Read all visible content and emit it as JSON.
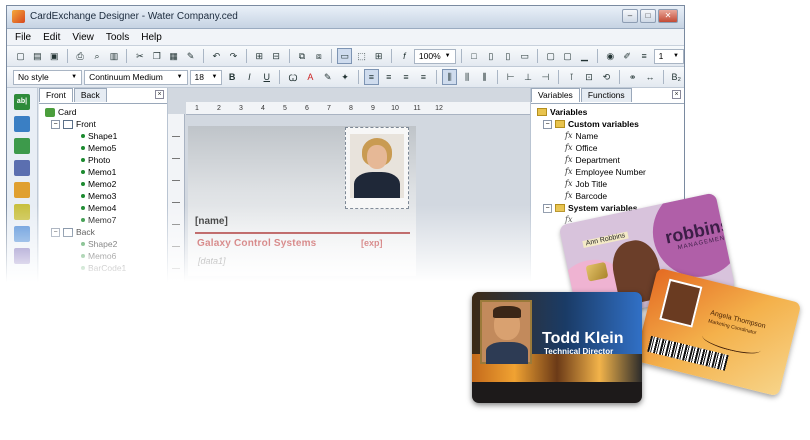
{
  "window": {
    "title": "CardExchange Designer - Water Company.ced",
    "controls": [
      "–",
      "□",
      "✕"
    ]
  },
  "menu": [
    "File",
    "Edit",
    "View",
    "Tools",
    "Help"
  ],
  "toolbar1": {
    "zoom": "100%",
    "line_width": "1"
  },
  "toolbar2": {
    "style": "No style",
    "font": "Continuum Medium",
    "size": "18"
  },
  "tree": {
    "tabs": [
      "Front",
      "Back"
    ],
    "root": "Card",
    "front_label": "Front",
    "front_items": [
      "Shape1",
      "Memo5",
      "Photo",
      "Memo1",
      "Memo2",
      "Memo3",
      "Memo4",
      "Memo7"
    ],
    "back_label": "Back",
    "back_items": [
      "Shape2",
      "Memo6",
      "BarCode1"
    ]
  },
  "ruler": [
    "1",
    "2",
    "3",
    "4",
    "5",
    "6",
    "7",
    "8",
    "9",
    "10",
    "11",
    "12"
  ],
  "design": {
    "name_field": "[name]",
    "company": "Galaxy Control Systems",
    "exp_field": "[exp]",
    "data_field": "[data1]"
  },
  "variables": {
    "tabs": [
      "Variables",
      "Functions"
    ],
    "root": "Variables",
    "custom_label": "Custom variables",
    "custom_items": [
      "Name",
      "Office",
      "Department",
      "Employee Number",
      "Job Title",
      "Barcode"
    ],
    "system_label": "System variables",
    "system_items": [
      "",
      ""
    ]
  },
  "cards": {
    "purple": {
      "brand": "robbins",
      "brand_sub": "MANAGEMENT",
      "holder": "Ann Robbins"
    },
    "black": {
      "name": "Todd Klein",
      "title": "Technical Director"
    },
    "orange": {
      "name": "Angela Thompson",
      "role": "Marketing Coordinator"
    }
  },
  "colors": {
    "accent_red": "#b31b1b",
    "title_bg": "#c6d3e3",
    "card_gray": "#bfc4c9"
  }
}
